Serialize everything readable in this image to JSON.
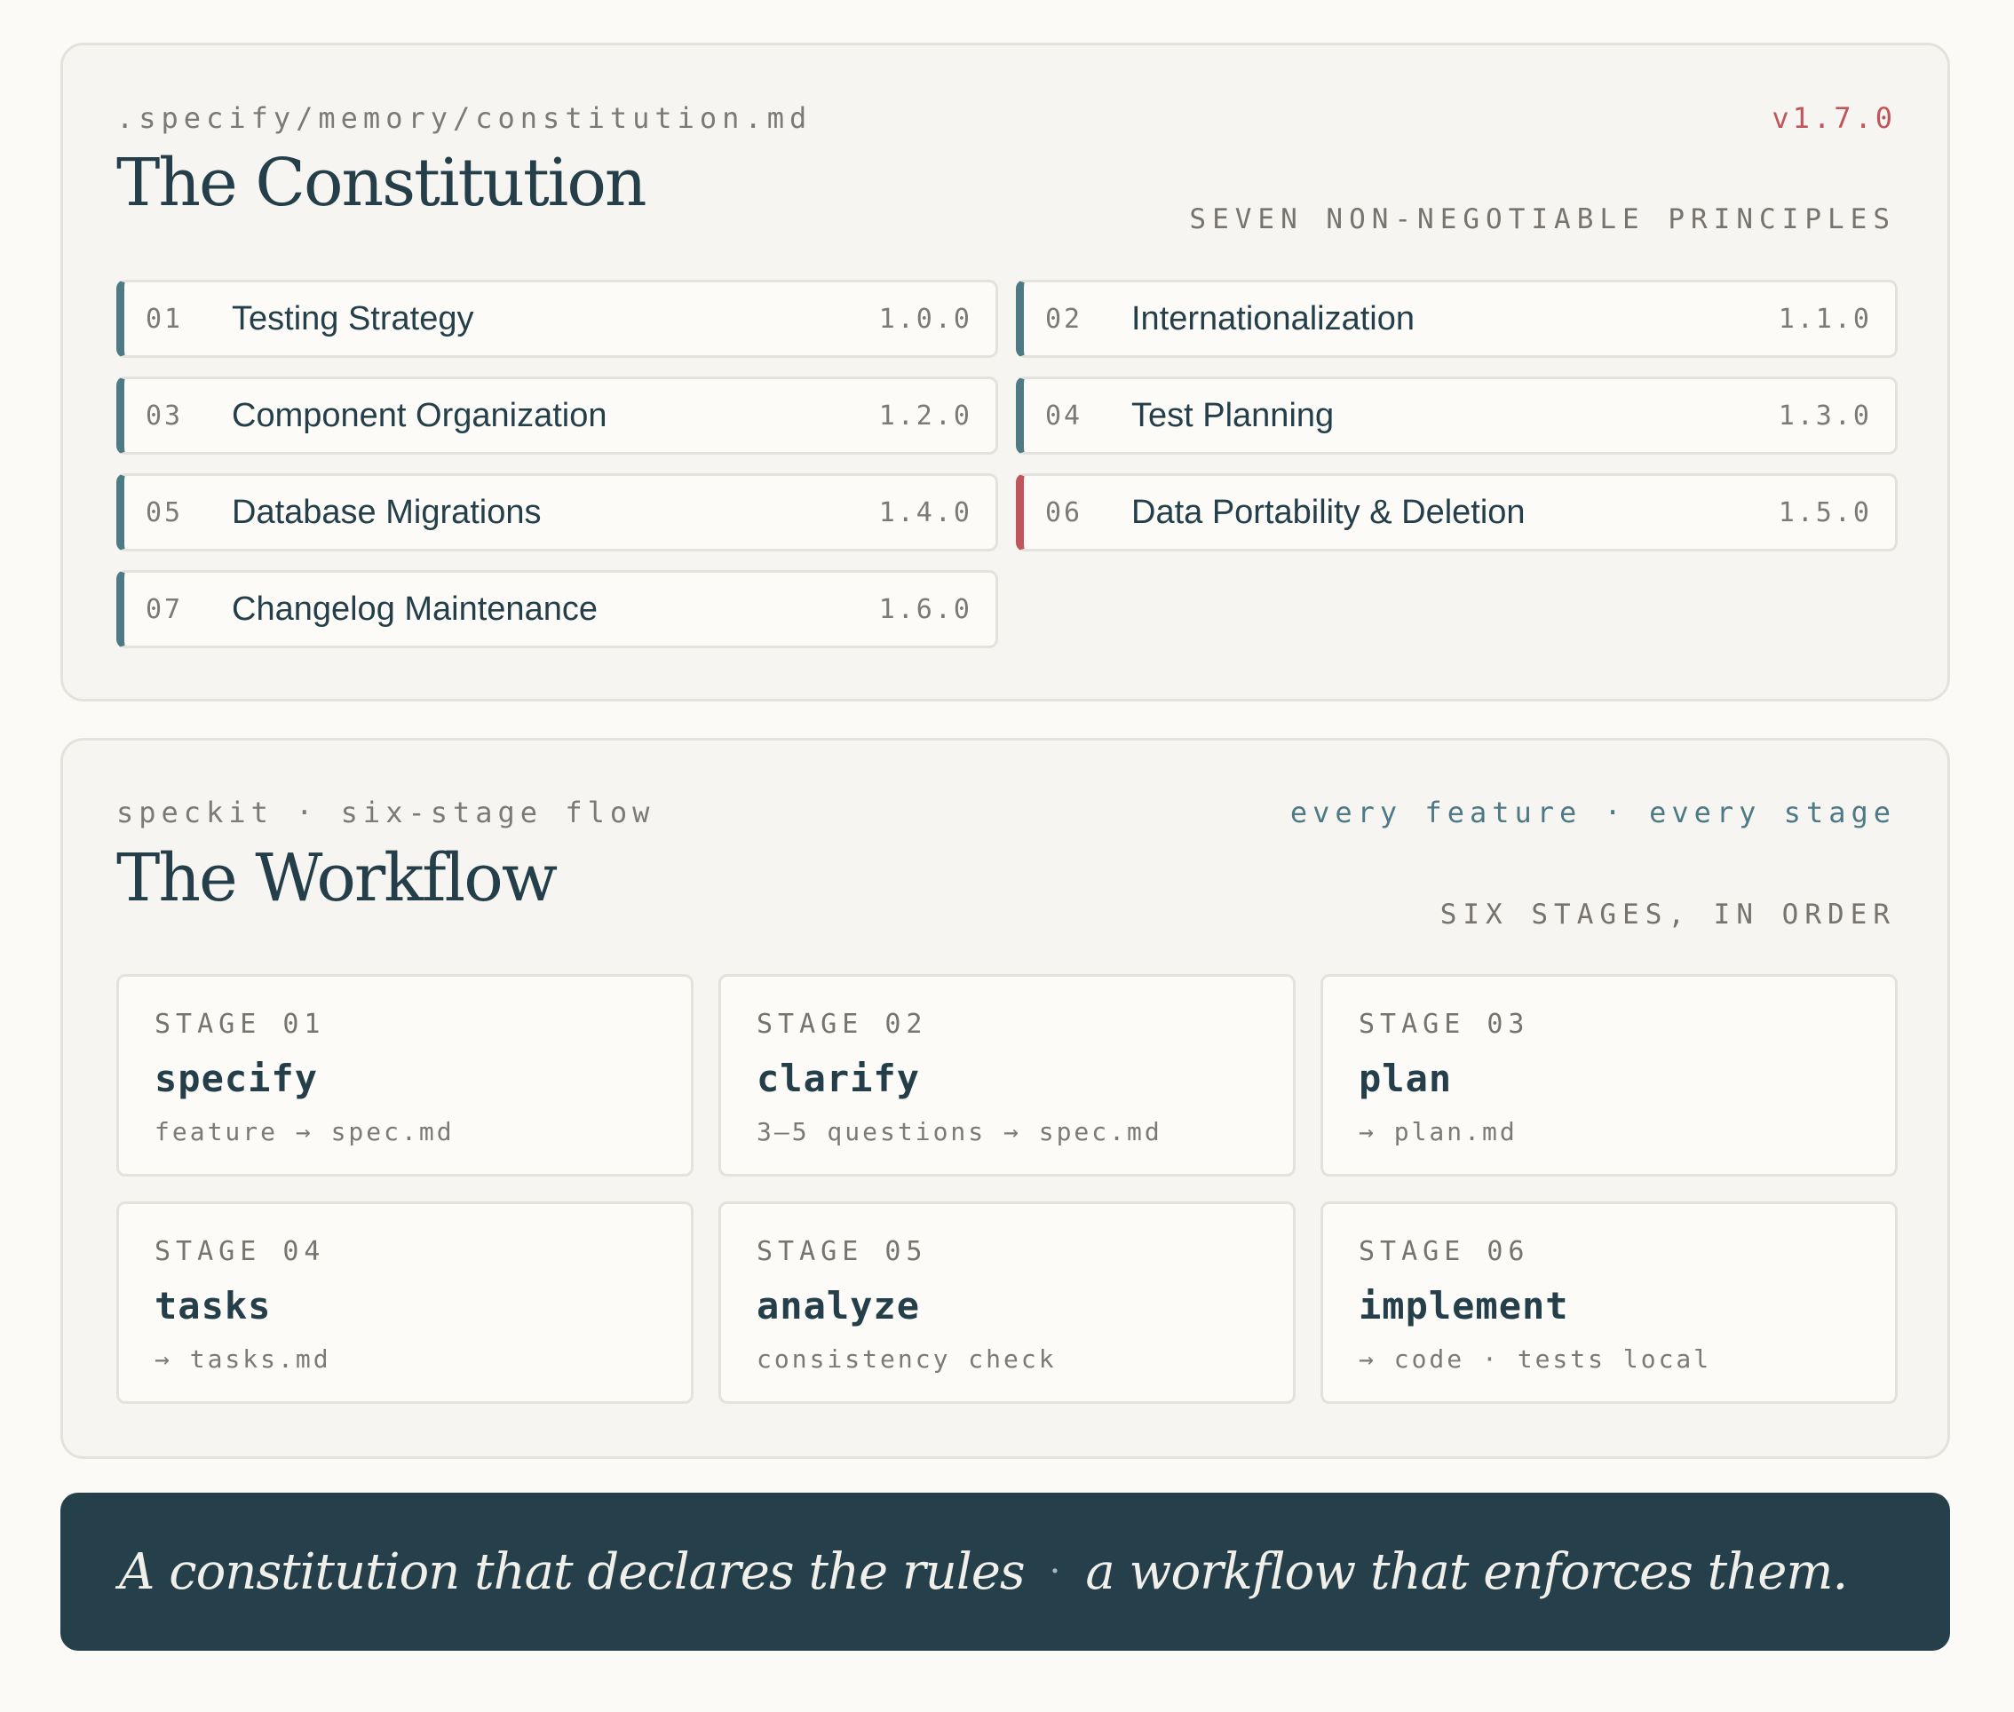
{
  "constitution": {
    "path": ".specify/memory/constitution.md",
    "version": "v1.7.0",
    "title": "The Constitution",
    "subtitle": "SEVEN NON-NEGOTIABLE PRINCIPLES",
    "principles": [
      {
        "num": "01",
        "name": "Testing Strategy",
        "version": "1.0.0"
      },
      {
        "num": "02",
        "name": "Internationalization",
        "version": "1.1.0"
      },
      {
        "num": "03",
        "name": "Component Organization",
        "version": "1.2.0"
      },
      {
        "num": "04",
        "name": "Test Planning",
        "version": "1.3.0"
      },
      {
        "num": "05",
        "name": "Database Migrations",
        "version": "1.4.0"
      },
      {
        "num": "06",
        "name": "Data Portability & Deletion",
        "version": "1.5.0"
      },
      {
        "num": "07",
        "name": "Changelog Maintenance",
        "version": "1.6.0"
      }
    ],
    "accent_color": "#4e7a85",
    "highlight_color": "#c0565a"
  },
  "workflow": {
    "eyebrow_left": "speckit · six-stage flow",
    "eyebrow_right": "every feature · every stage",
    "title": "The Workflow",
    "subtitle": "SIX STAGES, IN ORDER",
    "stages": [
      {
        "label": "STAGE 01",
        "command": "specify",
        "detail": "feature → spec.md"
      },
      {
        "label": "STAGE 02",
        "command": "clarify",
        "detail": "3–5 questions → spec.md"
      },
      {
        "label": "STAGE 03",
        "command": "plan",
        "detail": "→ plan.md"
      },
      {
        "label": "STAGE 04",
        "command": "tasks",
        "detail": "→ tasks.md"
      },
      {
        "label": "STAGE 05",
        "command": "analyze",
        "detail": "consistency check"
      },
      {
        "label": "STAGE 06",
        "command": "implement",
        "detail": "→ code · tests local"
      }
    ]
  },
  "banner": {
    "part1": "A constitution that declares the rules",
    "separator": "·",
    "part2": "a workflow that enforces them.",
    "background_color": "#25404b"
  }
}
